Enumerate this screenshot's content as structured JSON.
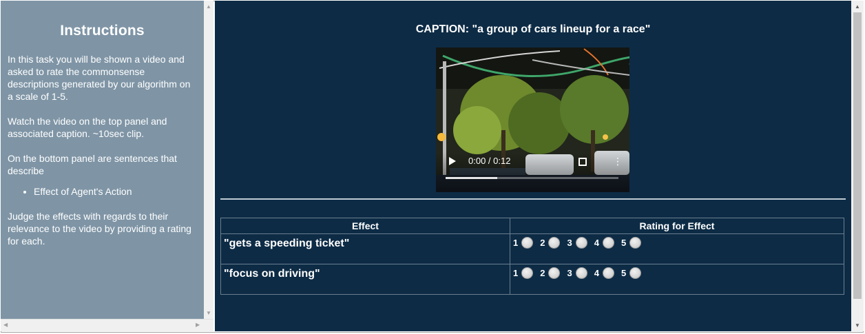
{
  "instructions": {
    "title": "Instructions",
    "paragraph1": "In this task you will be shown a video and asked to rate the commonsense descriptions generated by our algorithm on a scale of 1-5.",
    "paragraph2": "Watch the video on the top panel and associated caption. ~10sec clip.",
    "paragraph3": "On the bottom panel are sentences that describe",
    "bullets": [
      "Effect of Agent's Action"
    ],
    "paragraph4": "Judge the effects with regards to their relevance to the video by providing a rating for each."
  },
  "caption": "CAPTION: \"a group of cars lineup for a race\"",
  "video": {
    "time_display": "0:00 / 0:12",
    "progress": 0.3
  },
  "table": {
    "headers": [
      "Effect",
      "Rating for Effect"
    ],
    "rows": [
      {
        "effect": "\"gets a speeding ticket\""
      },
      {
        "effect": "\"focus on driving\""
      }
    ],
    "rating_options": [
      "1",
      "2",
      "3",
      "4",
      "5"
    ]
  },
  "colors": {
    "left_panel_bg": "#7f95a6",
    "right_panel_bg": "#0d2b45"
  }
}
